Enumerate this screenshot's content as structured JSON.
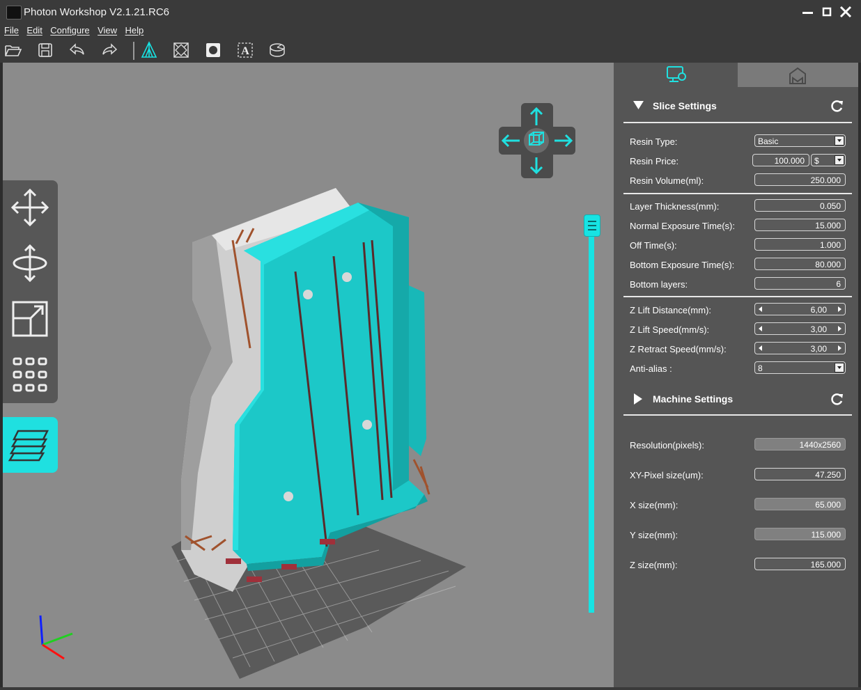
{
  "window": {
    "title": "Photon Workshop V2.1.21.RC6"
  },
  "menu": [
    "File",
    "Edit",
    "Configure",
    "View",
    "Help"
  ],
  "toolbar": [
    "open-icon",
    "save-icon",
    "undo-icon",
    "redo-icon",
    "supports-icon",
    "hollow-icon",
    "punch-hole-icon",
    "text-icon",
    "slice-icon"
  ],
  "slice_settings": {
    "title": "Slice Settings",
    "resin_type": {
      "label": "Resin Type:",
      "value": "Basic"
    },
    "resin_price": {
      "label": "Resin Price:",
      "value": "100.000",
      "currency": "$"
    },
    "resin_volume": {
      "label": "Resin Volume(ml):",
      "value": "250.000"
    },
    "layer_thickness": {
      "label": "Layer Thickness(mm):",
      "value": "0.050"
    },
    "normal_exposure": {
      "label": "Normal Exposure Time(s):",
      "value": "15.000"
    },
    "off_time": {
      "label": "Off Time(s):",
      "value": "1.000"
    },
    "bottom_exposure": {
      "label": "Bottom Exposure Time(s):",
      "value": "80.000"
    },
    "bottom_layers": {
      "label": "Bottom layers:",
      "value": "6"
    },
    "z_lift_distance": {
      "label": "Z Lift Distance(mm):",
      "value": "6,00"
    },
    "z_lift_speed": {
      "label": "Z Lift Speed(mm/s):",
      "value": "3,00"
    },
    "z_retract_speed": {
      "label": "Z Retract Speed(mm/s):",
      "value": "3,00"
    },
    "anti_alias": {
      "label": "Anti-alias :",
      "value": "8"
    }
  },
  "machine_settings": {
    "title": "Machine Settings",
    "resolution": {
      "label": "Resolution(pixels):",
      "value": "1440x2560"
    },
    "xy_pixel": {
      "label": "XY-Pixel size(um):",
      "value": "47.250"
    },
    "x_size": {
      "label": "X size(mm):",
      "value": "65.000"
    },
    "y_size": {
      "label": "Y size(mm):",
      "value": "115.000"
    },
    "z_size": {
      "label": "Z size(mm):",
      "value": "165.000"
    }
  },
  "colors": {
    "accent": "#17e3e3",
    "panel": "#555555",
    "viewport": "#8b8b8b",
    "model": "#1cc8c8"
  }
}
